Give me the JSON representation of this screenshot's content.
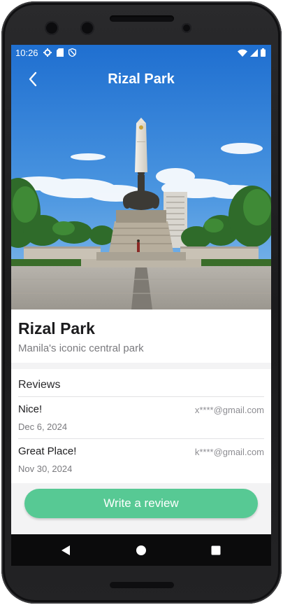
{
  "status_bar": {
    "time": "10:26",
    "left_icons": [
      "gear-icon",
      "sd-card-icon",
      "shield-icon"
    ],
    "right_icons": [
      "wifi-icon",
      "cell-signal-icon",
      "battery-icon"
    ]
  },
  "app_bar": {
    "title": "Rizal Park",
    "back_icon": "chevron-left-icon"
  },
  "place": {
    "name": "Rizal Park",
    "tagline": "Manila's iconic central park",
    "hero_image": "monument-photo"
  },
  "reviews": {
    "heading": "Reviews",
    "items": [
      {
        "title": "Nice!",
        "email": "x****@gmail.com",
        "date": "Dec 6, 2024"
      },
      {
        "title": "Great Place!",
        "email": "k****@gmail.com",
        "date": "Nov 30, 2024"
      }
    ]
  },
  "actions": {
    "write_review_label": "Write a review"
  },
  "nav_bar": {
    "icons": [
      "back-triangle-icon",
      "home-circle-icon",
      "recents-square-icon"
    ]
  },
  "colors": {
    "accent": "#57c994",
    "sky": "#2f7fd6",
    "nav_bar": "#0b0b0c",
    "frame": "#1f1f21"
  }
}
